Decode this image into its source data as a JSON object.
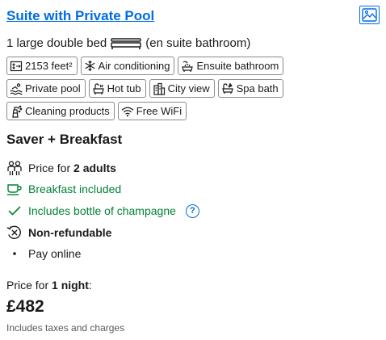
{
  "room": {
    "title": "Suite with Private Pool",
    "bed_text": "1 large double bed",
    "bed_note": "(en suite bathroom)",
    "gallery_icon": "image-icon"
  },
  "facilities": [
    {
      "icon": "size-icon",
      "label": "2153 feet²"
    },
    {
      "icon": "snowflake-icon",
      "label": "Air conditioning"
    },
    {
      "icon": "bathroom-icon",
      "label": "Ensuite bathroom"
    },
    {
      "icon": "pool-icon",
      "label": "Private pool"
    },
    {
      "icon": "hot-tub-icon",
      "label": "Hot tub"
    },
    {
      "icon": "city-icon",
      "label": "City view"
    },
    {
      "icon": "spa-bath-icon",
      "label": "Spa bath"
    },
    {
      "icon": "cleaning-icon",
      "label": "Cleaning products"
    },
    {
      "icon": "wifi-icon",
      "label": "Free WiFi"
    }
  ],
  "offer": {
    "title": "Saver + Breakfast",
    "guests_prefix": "Price for",
    "guests_value": "2 adults",
    "breakfast": "Breakfast included",
    "champagne": "Includes bottle of champagne",
    "info_glyph": "?",
    "refund": "Non-refundable",
    "payment": "Pay online"
  },
  "pricing": {
    "prefix": "Price for",
    "nights": "1 night",
    "suffix": ":",
    "amount": "£482",
    "taxes_note": "Includes taxes and charges"
  },
  "colors": {
    "link": "#006ce4",
    "positive": "#008234",
    "text": "#1a1a1a",
    "muted": "#595959"
  }
}
